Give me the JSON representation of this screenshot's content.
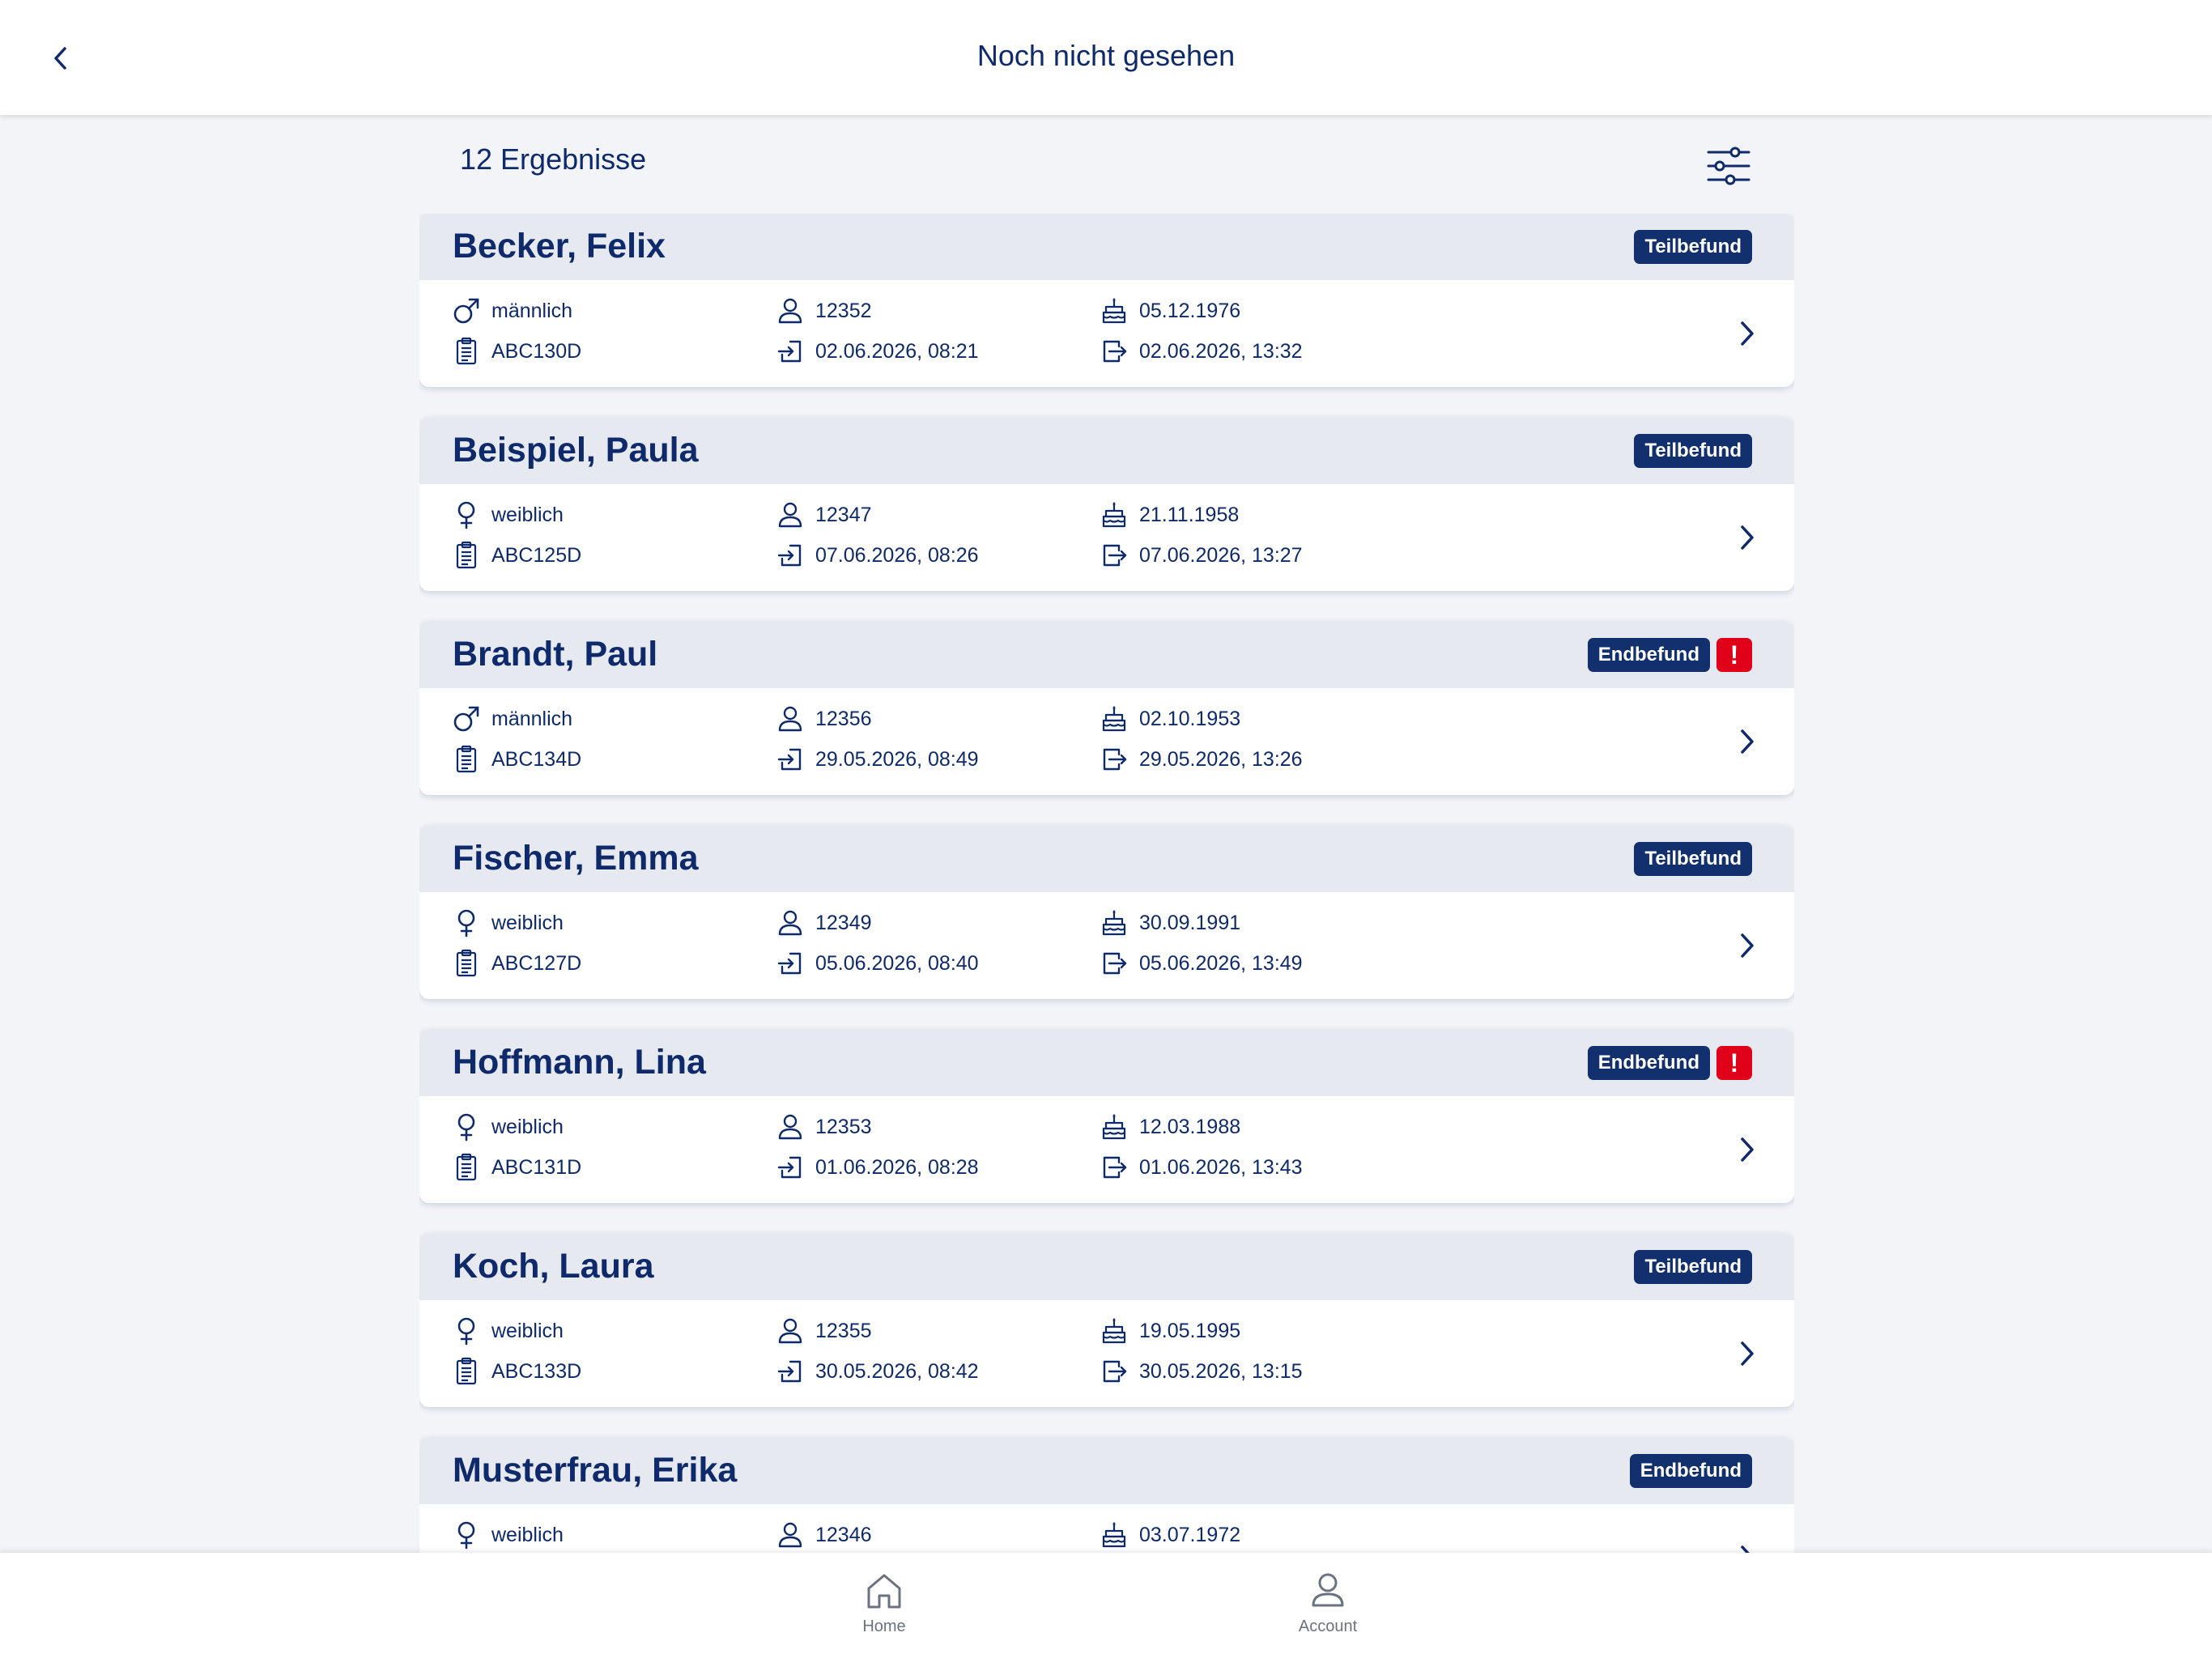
{
  "header": {
    "title": "Noch nicht gesehen",
    "back_icon": "chevron-left-icon"
  },
  "results": {
    "count_label": "12 Ergebnisse",
    "filter_icon": "sliders-icon"
  },
  "patients": [
    {
      "name": "Becker, Felix",
      "status": "Teilbefund",
      "alert": false,
      "gender": "männlich",
      "gender_icon": "male-icon",
      "id": "12352",
      "birthdate": "05.12.1976",
      "case": "ABC130D",
      "admission": "02.06.2026, 08:21",
      "discharge": "02.06.2026, 13:32"
    },
    {
      "name": "Beispiel, Paula",
      "status": "Teilbefund",
      "alert": false,
      "gender": "weiblich",
      "gender_icon": "female-icon",
      "id": "12347",
      "birthdate": "21.11.1958",
      "case": "ABC125D",
      "admission": "07.06.2026, 08:26",
      "discharge": "07.06.2026, 13:27"
    },
    {
      "name": "Brandt, Paul",
      "status": "Endbefund",
      "alert": true,
      "alert_text": "!",
      "gender": "männlich",
      "gender_icon": "male-icon",
      "id": "12356",
      "birthdate": "02.10.1953",
      "case": "ABC134D",
      "admission": "29.05.2026, 08:49",
      "discharge": "29.05.2026, 13:26"
    },
    {
      "name": "Fischer, Emma",
      "status": "Teilbefund",
      "alert": false,
      "gender": "weiblich",
      "gender_icon": "female-icon",
      "id": "12349",
      "birthdate": "30.09.1991",
      "case": "ABC127D",
      "admission": "05.06.2026, 08:40",
      "discharge": "05.06.2026, 13:49"
    },
    {
      "name": "Hoffmann, Lina",
      "status": "Endbefund",
      "alert": true,
      "alert_text": "!",
      "gender": "weiblich",
      "gender_icon": "female-icon",
      "id": "12353",
      "birthdate": "12.03.1988",
      "case": "ABC131D",
      "admission": "01.06.2026, 08:28",
      "discharge": "01.06.2026, 13:43"
    },
    {
      "name": "Koch, Laura",
      "status": "Teilbefund",
      "alert": false,
      "gender": "weiblich",
      "gender_icon": "female-icon",
      "id": "12355",
      "birthdate": "19.05.1995",
      "case": "ABC133D",
      "admission": "30.05.2026, 08:42",
      "discharge": "30.05.2026, 13:15"
    },
    {
      "name": "Musterfrau, Erika",
      "status": "Endbefund",
      "alert": false,
      "gender": "weiblich",
      "gender_icon": "female-icon",
      "id": "12346",
      "birthdate": "03.07.1972",
      "case": "",
      "admission": "",
      "discharge": ""
    }
  ],
  "nav": {
    "home_label": "Home",
    "home_icon": "home-icon",
    "account_label": "Account",
    "account_icon": "account-icon"
  },
  "colors": {
    "primary": "#0e2a6b",
    "badge": "#13306e",
    "alert": "#e0001a",
    "card_header": "#e6e9f0",
    "background": "#f2f4f8"
  }
}
